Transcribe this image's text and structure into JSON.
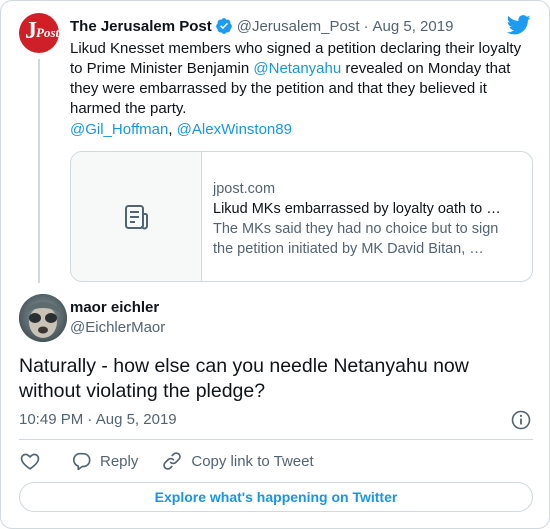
{
  "parent_tweet": {
    "author_name": "The Jerusalem Post",
    "handle": "@Jerusalem_Post",
    "separator": "·",
    "date": "Aug 5, 2019",
    "avatar_text": {
      "letter": "J",
      "rest": "Post"
    },
    "body_parts": [
      "Likud Knesset members who signed a petition declaring their loyalty to Prime Minister Benjamin ",
      "@Netanyahu",
      " revealed on Monday that they were embarrassed by the petition and that they believed it harmed the party."
    ],
    "mentions": [
      "@Gil_Hoffman",
      ", ",
      "@AlexWinston89"
    ],
    "link_card": {
      "domain": "jpost.com",
      "title": "Likud MKs embarrassed by loyalty oath to …",
      "description_lines": [
        "The MKs said they had no choice but to sign",
        "the petition initiated by MK David Bitan, …"
      ]
    }
  },
  "reply_tweet": {
    "author_name": "maor eichler",
    "handle": "@EichlerMaor",
    "body": "Naturally - how else can you needle Netanyahu now without violating the pledge?",
    "time": "10:49 PM",
    "separator": "·",
    "date": "Aug 5, 2019"
  },
  "actions": {
    "like_icon": "heart-icon",
    "reply_label": "Reply",
    "reply_icon": "speech-bubble-icon",
    "copy_label": "Copy link to Tweet",
    "copy_icon": "link-icon"
  },
  "explore_button": {
    "label": "Explore what's happening on Twitter"
  },
  "colors": {
    "accent": "#1b95e0",
    "verified": "#1d9bf0",
    "jpost_red": "#cf1f27",
    "muted_text": "#536471",
    "border": "#cfd9de"
  }
}
